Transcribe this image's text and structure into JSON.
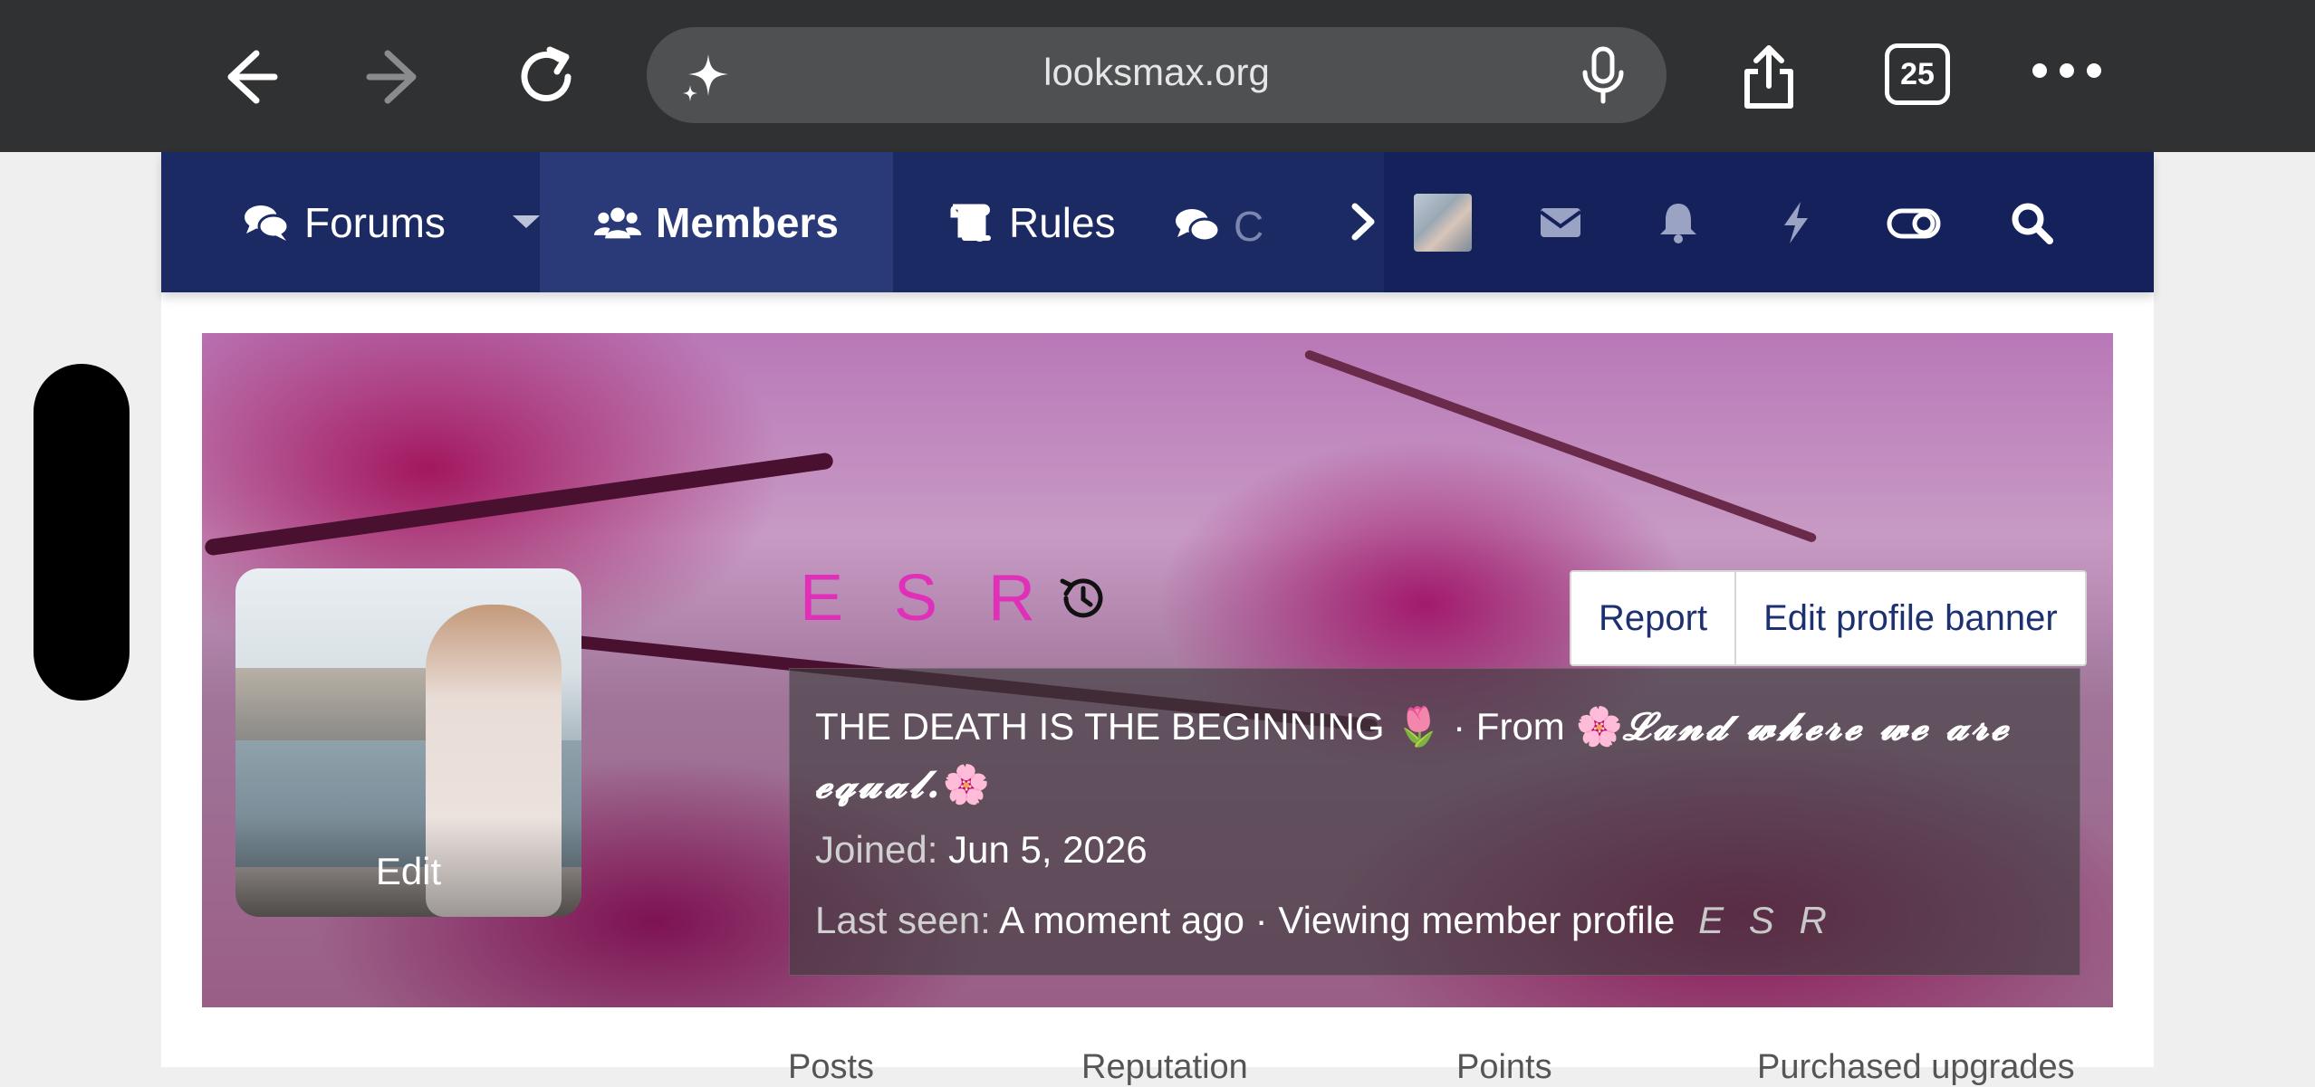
{
  "browser": {
    "url": "looksmax.org",
    "tab_count": "25",
    "icons": [
      "back-arrow-icon",
      "forward-arrow-icon",
      "reload-icon",
      "sparkle-icon",
      "mic-icon",
      "share-icon",
      "tabs-icon",
      "more-icon"
    ]
  },
  "nav": {
    "forums": "Forums",
    "members": "Members",
    "rules": "Rules",
    "chat": "C"
  },
  "profile": {
    "username": "E S R",
    "avatar_edit": "Edit",
    "report": "Report",
    "edit_banner": "Edit profile banner",
    "headline_prefix": "THE DEATH IS THE BEGINNING 🌷 · From 🌸",
    "headline_fancy": "𝓛𝓪𝓷𝓭 𝔀𝓱𝓮𝓻𝓮 𝔀𝓮 𝓪𝓻𝓮 𝓮𝓺𝓾𝓪𝓵.",
    "headline_suffix": "🌸",
    "joined_label": "Joined:",
    "joined_value": "Jun 5, 2026",
    "last_seen_label": "Last seen:",
    "last_seen_value": "A moment ago · Viewing member profile",
    "last_seen_user": "E S R"
  },
  "stats": {
    "posts": "Posts",
    "reputation": "Reputation",
    "points": "Points",
    "purchased": "Purchased upgrades"
  },
  "colors": {
    "nav_bg": "#1b2a63",
    "nav_active": "#2a3a78",
    "username": "#e02fb8",
    "button_text": "#1d3170"
  }
}
